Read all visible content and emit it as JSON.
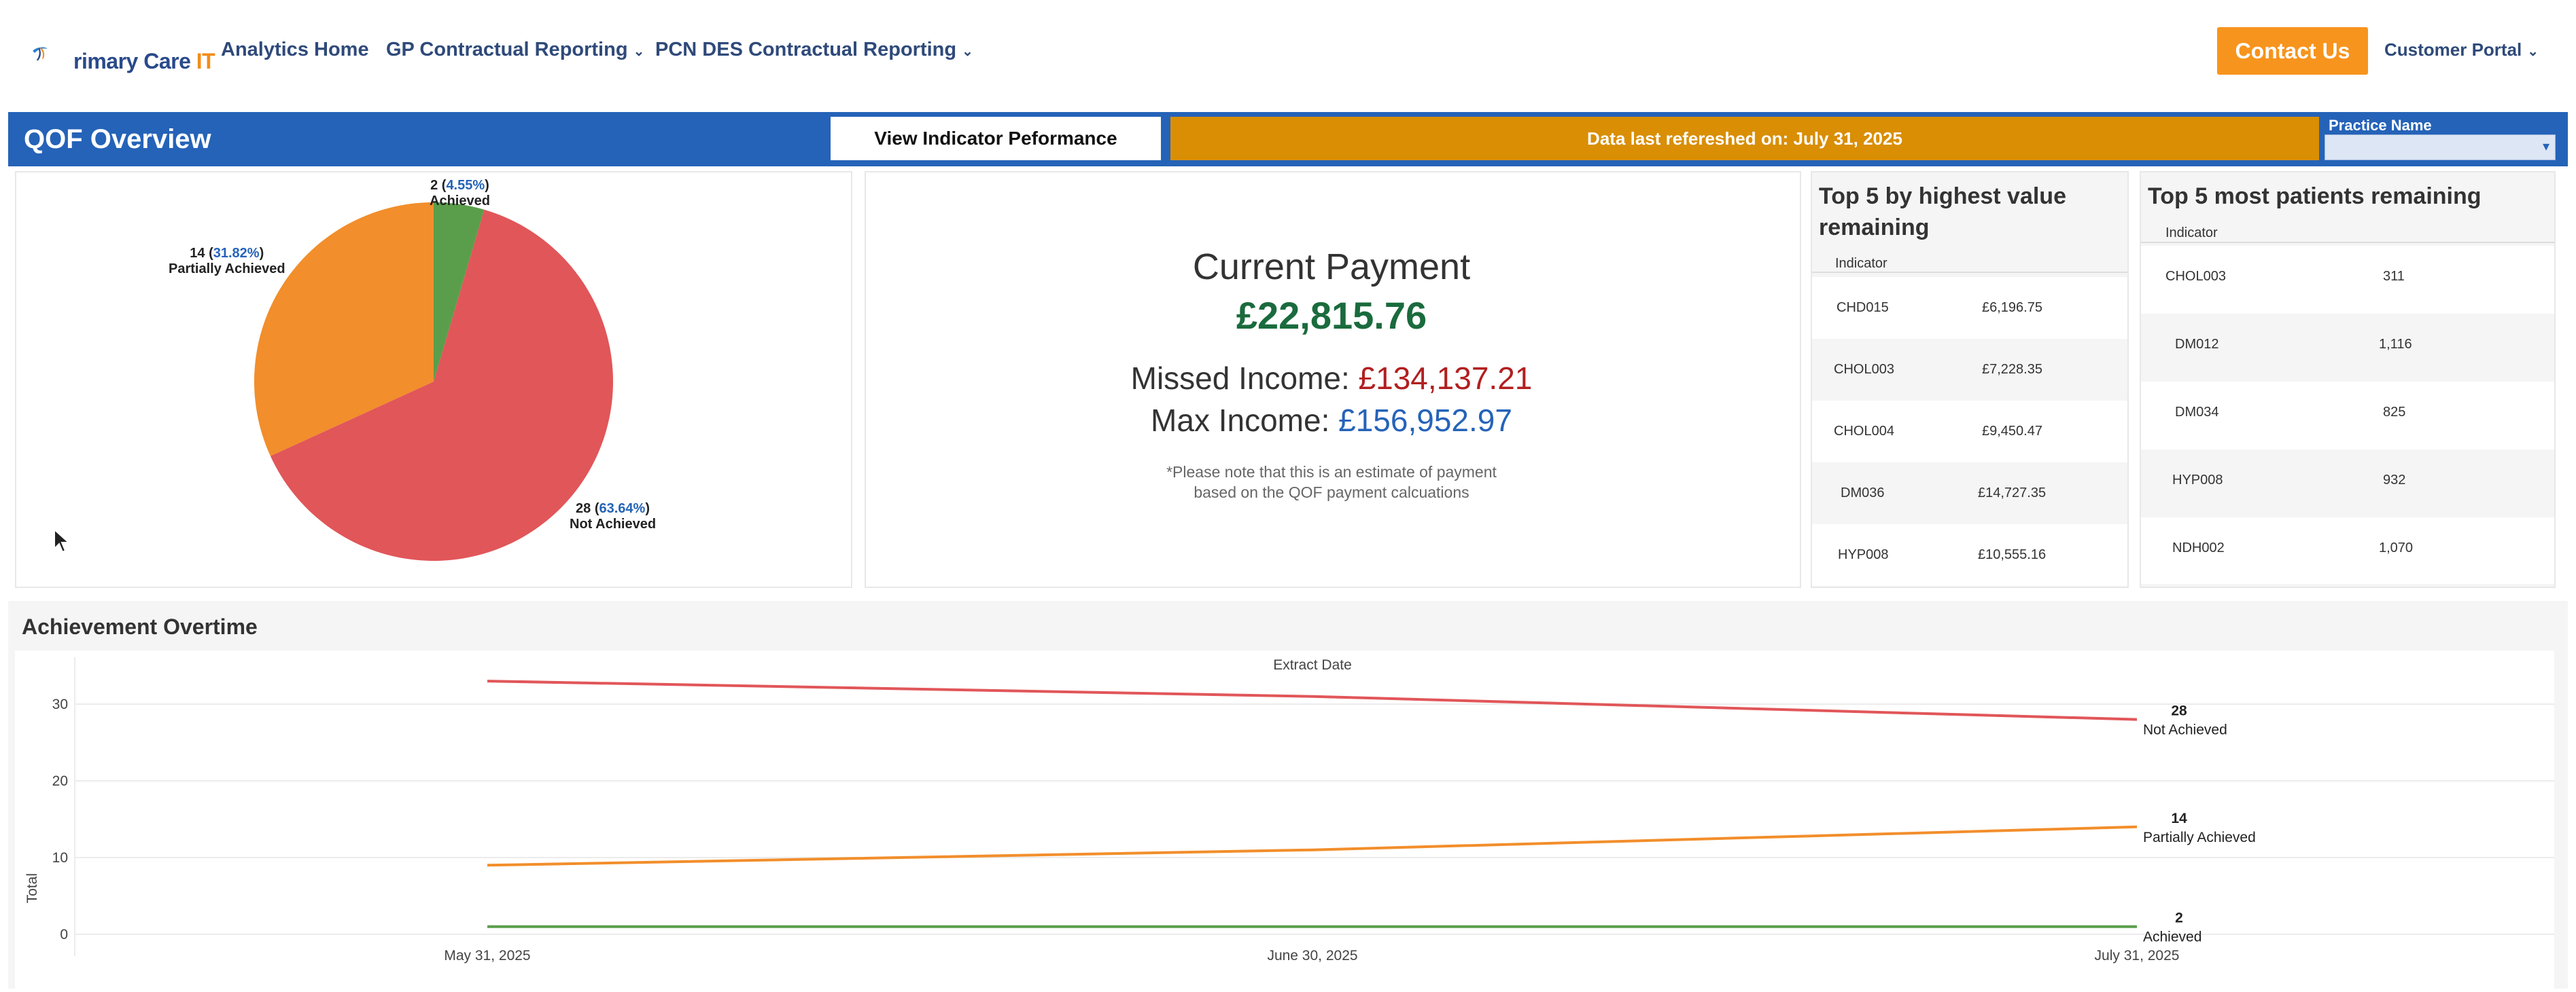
{
  "nav": {
    "logo_main": "rimary Care ",
    "logo_accent": "IT",
    "items": [
      {
        "label": "Analytics Home",
        "dropdown": false
      },
      {
        "label": "GP Contractual Reporting",
        "dropdown": true
      },
      {
        "label": "PCN DES Contractual Reporting",
        "dropdown": true
      }
    ],
    "contact_label": "Contact Us",
    "portal_label": "Customer Portal"
  },
  "header": {
    "title": "QOF Overview",
    "view_button": "View Indicator Peformance",
    "refresh_text": "Data last refereshed on: July 31, 2025",
    "practice_label": "Practice Name",
    "practice_value": ""
  },
  "pie": {
    "slices": [
      {
        "count": "2",
        "pct": "4.55%",
        "name": "Achieved",
        "value": 4.55,
        "color": "#5a9e4b"
      },
      {
        "count": "28",
        "pct": "63.64%",
        "name": "Not Achieved",
        "value": 63.64,
        "color": "#e15659"
      },
      {
        "count": "14",
        "pct": "31.82%",
        "name": "Partially Achieved",
        "value": 31.82,
        "color": "#f28e2b"
      }
    ]
  },
  "payment": {
    "title": "Current Payment",
    "current": "£22,815.76",
    "missed_label": "Missed Income: ",
    "missed": "£134,137.21",
    "max_label": "Max Income: ",
    "max": "£156,952.97",
    "note_line1": "*Please note that this is an estimate of payment",
    "note_line2": "based on the QOF payment calcuations"
  },
  "top5_value": {
    "title_line1": "Top 5 by highest value",
    "title_line2": "remaining",
    "header": "Indicator",
    "rows": [
      {
        "indicator": "CHD015",
        "value": "£6,196.75"
      },
      {
        "indicator": "CHOL003",
        "value": "£7,228.35"
      },
      {
        "indicator": "CHOL004",
        "value": "£9,450.47"
      },
      {
        "indicator": "DM036",
        "value": "£14,727.35"
      },
      {
        "indicator": "HYP008",
        "value": "£10,555.16"
      }
    ]
  },
  "top5_patients": {
    "title": "Top 5 most patients remaining",
    "header": "Indicator",
    "rows": [
      {
        "indicator": "CHOL003",
        "value": "311"
      },
      {
        "indicator": "DM012",
        "value": "1,116"
      },
      {
        "indicator": "DM034",
        "value": "825"
      },
      {
        "indicator": "HYP008",
        "value": "932"
      },
      {
        "indicator": "NDH002",
        "value": "1,070"
      }
    ]
  },
  "achievement": {
    "title": "Achievement Overtime",
    "chart_data": {
      "type": "line",
      "title": "",
      "xlabel": "Extract Date",
      "ylabel": "Total",
      "x": [
        "May 31, 2025",
        "June 30, 2025",
        "July 31, 2025"
      ],
      "y_ticks": [
        "0",
        "10",
        "20",
        "30"
      ],
      "ylim": [
        0,
        35
      ],
      "grid": true,
      "series": [
        {
          "name": "Not Achieved",
          "values": [
            33,
            31,
            28
          ],
          "color": "#e15659",
          "end_label": "28"
        },
        {
          "name": "Partially Achieved",
          "values": [
            9,
            11,
            14
          ],
          "color": "#f28e2b",
          "end_label": "14"
        },
        {
          "name": "Achieved",
          "values": [
            1,
            1,
            1
          ],
          "color": "#5a9e4b",
          "end_label": "2"
        }
      ]
    }
  }
}
